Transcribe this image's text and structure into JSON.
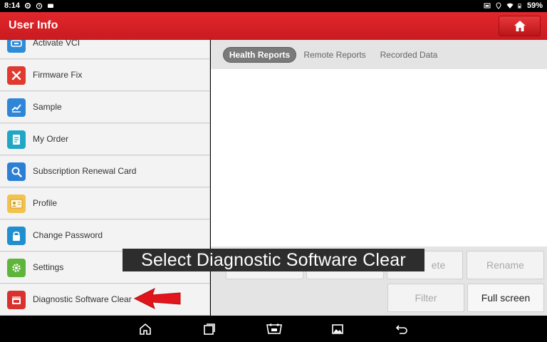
{
  "status_bar": {
    "time": "8:14",
    "battery": "59%",
    "left_icons": [
      "settings-gear-icon",
      "alarm-icon",
      "video-icon"
    ],
    "right_icons": [
      "cast-icon",
      "location-icon",
      "wifi-icon",
      "battery-icon"
    ]
  },
  "header": {
    "title": "User Info",
    "home_icon": "home-icon",
    "accent_color": "#d42027"
  },
  "sidebar": {
    "items": [
      {
        "label": "Activate VCI",
        "icon": "vci-icon",
        "color": "#2e8bd6"
      },
      {
        "label": "Firmware Fix",
        "icon": "tools-icon",
        "color": "#e03a2f"
      },
      {
        "label": "Sample",
        "icon": "chart-icon",
        "color": "#2f86d8"
      },
      {
        "label": "My Order",
        "icon": "order-icon",
        "color": "#22a6c6"
      },
      {
        "label": "Subscription Renewal Card",
        "icon": "search-card-icon",
        "color": "#2b7fd4"
      },
      {
        "label": "Profile",
        "icon": "profile-card-icon",
        "color": "#f2c24b"
      },
      {
        "label": "Change Password",
        "icon": "lock-icon",
        "color": "#1f8fcf"
      },
      {
        "label": "Settings",
        "icon": "gear-icon",
        "color": "#5fb43b"
      },
      {
        "label": "Diagnostic Software Clear",
        "icon": "software-clear-icon",
        "color": "#d9322e"
      }
    ]
  },
  "tabs": [
    {
      "label": "Health Reports",
      "active": true
    },
    {
      "label": "Remote Reports",
      "active": false
    },
    {
      "label": "Recorded Data",
      "active": false
    }
  ],
  "actions": {
    "delete_partial": "ete",
    "rename": "Rename",
    "filter": "Filter",
    "full_screen": "Full screen"
  },
  "caption": "Select Diagnostic Software Clear",
  "annotation_arrow_color": "#e0161c",
  "nav_icons": [
    "home-icon",
    "recent-apps-icon",
    "vci-icon",
    "image-icon",
    "back-icon"
  ]
}
